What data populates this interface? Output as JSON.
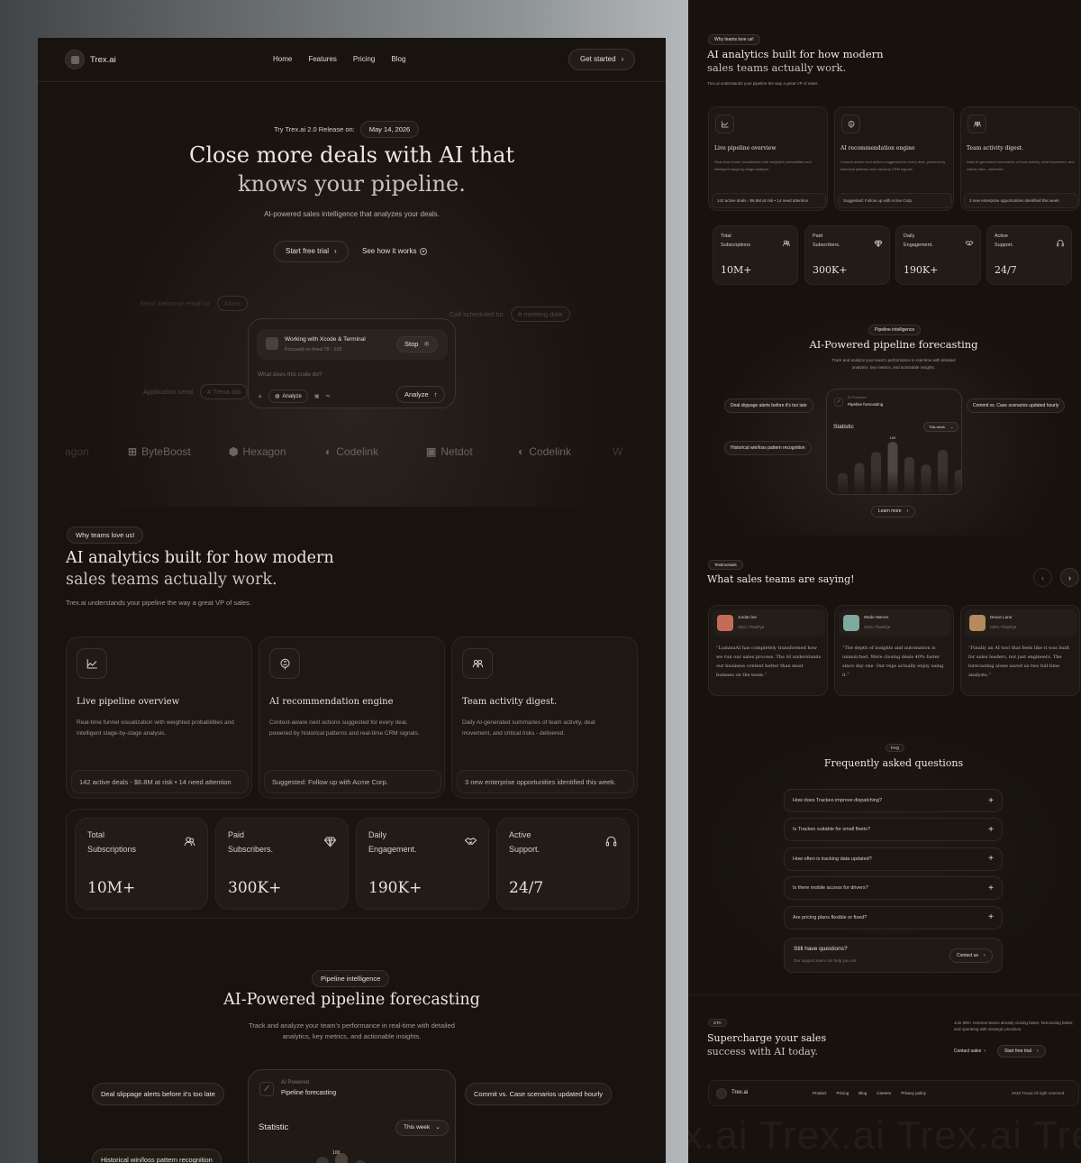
{
  "nav": {
    "brand": "Trex.ai",
    "links": [
      "Home",
      "Features",
      "Pricing",
      "Blog"
    ],
    "cta": "Get started"
  },
  "hero": {
    "release_prefix": "Try Trex.ai 2.0 Release on:",
    "release_date": "May 14, 2026",
    "title_line1": "Close more deals with AI that",
    "title_line2": "knows your pipeline.",
    "subtitle": "AI-powered sales intelligence that analyzes your deals.",
    "primary": "Start free trial",
    "secondary": "See how it works"
  },
  "demo": {
    "float1_label": "Send welcome email to",
    "float1_tag": "#Alex",
    "float2_label": "Call scheduled for",
    "float2_tag": "# meeting date",
    "float3_label": "Application send",
    "float3_tag": "# Trexa lab",
    "task_title": "Working with Xcode & Terminal",
    "task_sub": "Focused on lined 78 - 103",
    "stop": "Stop",
    "prompt": "What does this code do?",
    "analyze_chip": "Analyze",
    "analyze_btn": "Analyze"
  },
  "logos": [
    "ByteBoost",
    "Hexagon",
    "Codelink",
    "Netdot",
    "Codelink"
  ],
  "why": {
    "badge": "Why teams love us!",
    "title_line1": "AI analytics built for how modern",
    "title_line2": "sales teams actually work.",
    "subtitle": "Trex.ai understands your pipeline the way a great VP of sales.",
    "features": [
      {
        "icon": "chart-icon",
        "title": "Live pipeline overview",
        "desc": "Real-time funnel visualization with weighted probabilities and intelligent stage-by-stage analysis.",
        "footer": "142 active deals - $6.8M at risk • 14 need attention"
      },
      {
        "icon": "brain-icon",
        "title": "AI recommendation engine",
        "desc": "Context-aware next actions suggested for every deal, powered by historical patterns and real-time CRM signals.",
        "footer": "Suggested: Follow up with Acme Corp."
      },
      {
        "icon": "team-icon",
        "title": "Team activity digest.",
        "desc": "Daily AI-generated summaries of team activity, deal movement, and critical risks - delivered.",
        "footer": "3 new enterprise opportunities identified this week."
      }
    ],
    "stats": [
      {
        "label1": "Total",
        "label2": "Subscriptions",
        "value": "10M+",
        "icon": "users-icon"
      },
      {
        "label1": "Paid",
        "label2": "Subscribers.",
        "value": "300K+",
        "icon": "diamond-icon"
      },
      {
        "label1": "Daily",
        "label2": "Engagement.",
        "value": "190K+",
        "icon": "handshake-icon"
      },
      {
        "label1": "Active",
        "label2": "Support.",
        "value": "24/7",
        "icon": "headset-icon"
      }
    ]
  },
  "forecast": {
    "badge": "Pipeline intelligence",
    "title": "AI-Powered pipeline forecasting",
    "subtitle_line1": "Track and analyze your team's performance in real-time with detailed",
    "subtitle_line2": "analytics, key metrics, and actionable insights.",
    "chip1": "Deal slippage alerts before it's too late",
    "chip2": "Commit vs. Case scenarios updated hourly",
    "chip3": "Historical win/loss pattern recognition",
    "card_small": "AI Powered",
    "card_title": "Pipeline forecasting",
    "statistic": "Statistic",
    "range": "This week",
    "peak_label": "100",
    "learn_more": "Learn more"
  },
  "testimonials": {
    "badge": "Testimonials",
    "title": "What sales teams are saying!",
    "items": [
      {
        "name": "Jordan lee",
        "role": "CEO, FlowFye",
        "quote": "“LuminaAI has completely transformed how we run our sales process. The AI understands our business context better than most humans on the team.”",
        "color": "#c66b5a"
      },
      {
        "name": "Wade Warren",
        "role": "CEO, FlowFye",
        "quote": "“The depth of insights and automation is unmatched. Were closing deals 40% faster since day one. Our reps actually enjoy using it.”",
        "color": "#7fa8a0"
      },
      {
        "name": "Devon Lane",
        "role": "CEO, FlowFye",
        "quote": "“Finally an AI tool that feels like it was built for sales leaders, not just engineers. The forecasting alone saved us two full-time analysts.”",
        "color": "#b48a5e"
      }
    ]
  },
  "faq": {
    "badge": "FAQ",
    "title": "Frequently asked questions",
    "items": [
      "How does Trackeo improve dispatching?",
      "Is Trackeo suitable for small fleets?",
      "How often is tracking data updated?",
      "Is there mobile access for drivers?",
      "Are pricing plans flexible or fixed?"
    ],
    "still_title": "Still have questions?",
    "still_sub": "Our support team can help you out.",
    "contact": "Contact us"
  },
  "cta": {
    "badge": "CTA",
    "title_line1": "Supercharge your sales",
    "title_line2": "success with AI today.",
    "desc": "Join 800+ revenue teams already closing faster, forecasting better, and operating with strategic precision.",
    "contact": "Contact sales",
    "trial": "Start free trial"
  },
  "footer": {
    "brand": "Trex.ai",
    "links": [
      "Product",
      "Pricing",
      "Blog",
      "Careers",
      "Privacy policy"
    ],
    "copyright": "2026 Trexai All right reserved",
    "watermark": "x.ai Trex.ai Trex.ai Tre"
  },
  "chart_data": {
    "type": "bar",
    "values": [
      38,
      58,
      80,
      100,
      70,
      55,
      84,
      44
    ],
    "peak_label": "100"
  }
}
